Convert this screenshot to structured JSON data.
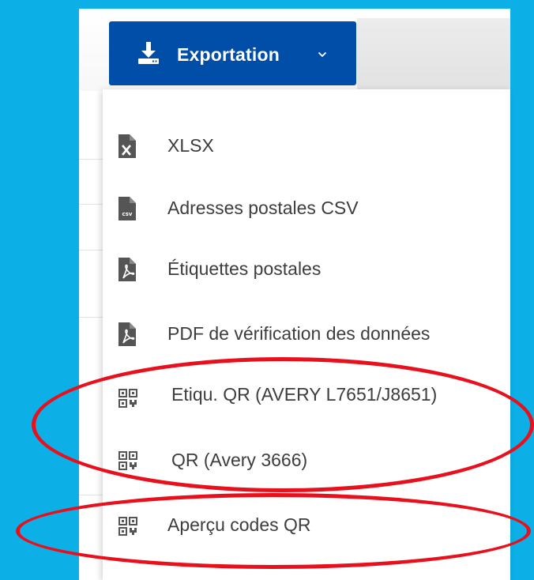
{
  "colors": {
    "background": "#0cb0e6",
    "button": "#004ea8",
    "icon": "#555555",
    "annotation": "#e8101c"
  },
  "export_button": {
    "label": "Exportation",
    "icon": "download-icon",
    "caret_icon": "chevron-down-icon"
  },
  "menu": {
    "items": [
      {
        "label": "XLSX",
        "icon": "xlsx-file-icon"
      },
      {
        "label": "Adresses postales CSV",
        "icon": "csv-file-icon"
      },
      {
        "label": "Étiquettes postales",
        "icon": "pdf-file-icon"
      },
      {
        "label": "PDF de vérification des données",
        "icon": "pdf-file-icon"
      },
      {
        "label": "Etiqu. QR (AVERY L7651/J8651)",
        "icon": "qr-code-icon"
      },
      {
        "label": "QR (Avery 3666)",
        "icon": "qr-code-icon"
      },
      {
        "label": "Aperçu codes QR",
        "icon": "qr-code-icon"
      }
    ]
  },
  "annotations": [
    {
      "shape": "ellipse",
      "surrounds": "menu items 5-6"
    },
    {
      "shape": "ellipse",
      "surrounds": "menu item 7"
    }
  ]
}
